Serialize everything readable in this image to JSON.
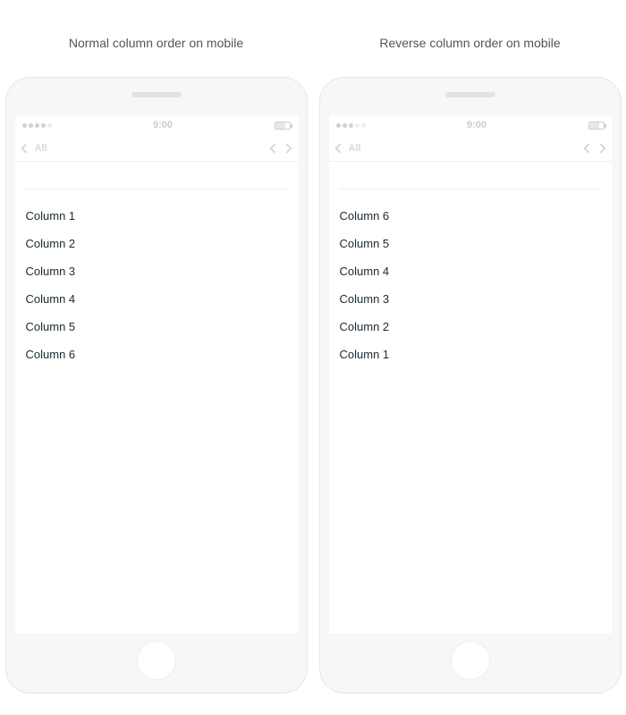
{
  "left": {
    "caption": "Normal column order on mobile",
    "statusbar": {
      "time": "9:00"
    },
    "navbar": {
      "label": "All"
    },
    "items": [
      "Column 1",
      "Column 2",
      "Column 3",
      "Column 4",
      "Column 5",
      "Column 6"
    ]
  },
  "right": {
    "caption": "Reverse column order on mobile",
    "statusbar": {
      "time": "9:00"
    },
    "navbar": {
      "label": "All"
    },
    "items": [
      "Column 6",
      "Column 5",
      "Column 4",
      "Column 3",
      "Column 2",
      "Column 1"
    ]
  }
}
